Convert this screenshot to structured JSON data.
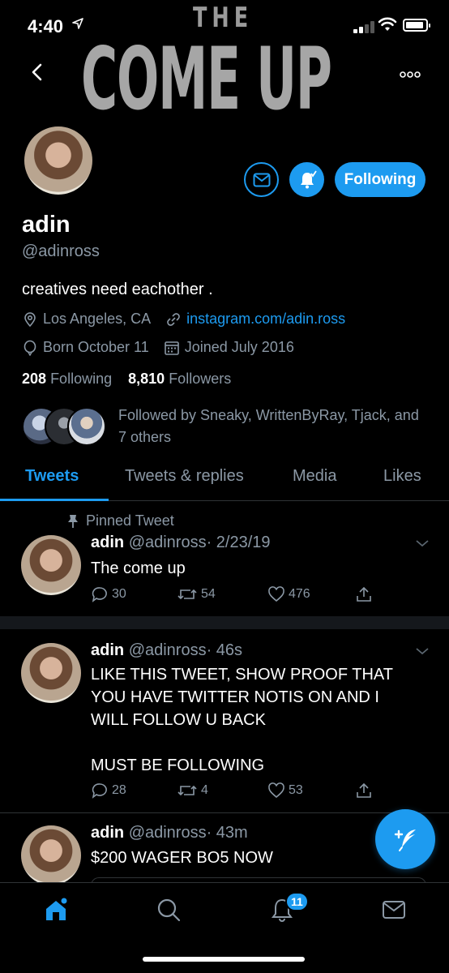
{
  "status_bar": {
    "time": "4:40"
  },
  "banner": {
    "line1": "THE",
    "line2": "COME UP"
  },
  "profile": {
    "name": "adin",
    "handle": "@adinross",
    "bio": "creatives need eachother .",
    "location": "Los Angeles, CA",
    "website": "instagram.com/adin.ross",
    "birthday": "Born October 11",
    "joined": "Joined July 2016",
    "following_count": "208",
    "following_label": "Following",
    "followers_count": "8,810",
    "followers_label": "Followers",
    "followed_by": "Followed by Sneaky, WrittenByRay, Tjack, and 7 others",
    "follow_button_label": "Following"
  },
  "tabs": [
    {
      "label": "Tweets"
    },
    {
      "label": "Tweets & replies"
    },
    {
      "label": "Media"
    },
    {
      "label": "Likes"
    }
  ],
  "tweets": [
    {
      "pinned_label": "Pinned Tweet",
      "name": "adin",
      "handle": "@adinross",
      "time": "· 2/23/19",
      "text": "The come up",
      "replies": "30",
      "retweets": "54",
      "likes": "476"
    },
    {
      "name": "adin",
      "handle": "@adinross",
      "time": "· 46s",
      "text": "LIKE THIS TWEET, SHOW PROOF THAT\nYOU HAVE TWITTER NOTIS ON AND I\nWILL FOLLOW U BACK\n\nMUST BE FOLLOWING",
      "replies": "28",
      "retweets": "4",
      "likes": "53"
    },
    {
      "name": "adin",
      "handle": "@adinross",
      "time": "· 43m",
      "text": "$200 WAGER BO5 NOW"
    }
  ],
  "bottom_nav": {
    "notifications_badge": "11"
  },
  "colors": {
    "accent": "#1d9bf0",
    "background": "#000000",
    "muted_text": "#8b98a5",
    "divider": "#2f3336"
  },
  "icons": [
    "back-icon",
    "more-icon",
    "mail-icon",
    "bell-icon",
    "location-icon",
    "link-icon",
    "birthday-icon",
    "calendar-icon",
    "pin-icon",
    "reply-icon",
    "retweet-icon",
    "like-icon",
    "share-icon",
    "chevron-down-icon",
    "compose-icon",
    "home-icon",
    "search-icon",
    "notifications-icon",
    "messages-icon"
  ]
}
